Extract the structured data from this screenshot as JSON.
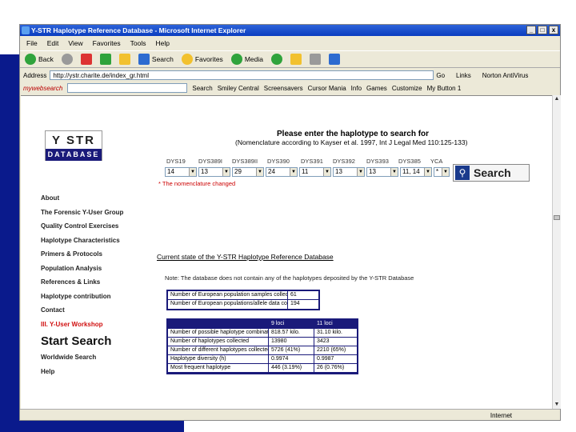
{
  "window": {
    "title": "Y-STR Haplotype Reference Database - Microsoft Internet Explorer",
    "buttons": [
      "_",
      "□",
      "x"
    ]
  },
  "menu": [
    "File",
    "Edit",
    "View",
    "Favorites",
    "Tools",
    "Help"
  ],
  "toolbar": {
    "back": "Back",
    "search": "Search",
    "favorites": "Favorites",
    "media": "Media"
  },
  "address": {
    "label": "Address",
    "url": "http://ystr.charite.de/index_gr.html",
    "go": "Go",
    "links": "Links",
    "norton": "Norton AntiVirus"
  },
  "searchbar": {
    "brand": "mywebsearch",
    "search": "Search",
    "smiley": "Smiley Central",
    "screensavers": "Screensavers",
    "cursor": "Cursor Mania",
    "info": "Info",
    "games": "Games",
    "customize": "Customize",
    "mybutton": "My Button 1"
  },
  "page": {
    "logo_top": "Y STR",
    "logo_bottom": "DATABASE",
    "heading": "Please enter the haplotype to search for",
    "subheading": "(Nomenclature according to Kayser et al. 1997, Int J Legal Med 110:125-133)",
    "loci": [
      {
        "name": "DYS19",
        "value": "14"
      },
      {
        "name": "DYS389I",
        "value": "13"
      },
      {
        "name": "DYS389II",
        "value": "29"
      },
      {
        "name": "DYS390",
        "value": "24"
      },
      {
        "name": "DYS391",
        "value": "11"
      },
      {
        "name": "DYS392",
        "value": "13"
      },
      {
        "name": "DYS393",
        "value": "13"
      },
      {
        "name": "DYS385",
        "value": "11, 14"
      },
      {
        "name": "YCA",
        "value": "*"
      }
    ],
    "note": "* The nomenclature changed",
    "search_button": "Search",
    "nav": [
      {
        "label": "About",
        "style": ""
      },
      {
        "label": "The Forensic Y-User Group",
        "style": ""
      },
      {
        "label": "Quality Control Exercises",
        "style": ""
      },
      {
        "label": "Haplotype Characteristics",
        "style": ""
      },
      {
        "label": "Primers & Protocols",
        "style": ""
      },
      {
        "label": "Population Analysis",
        "style": ""
      },
      {
        "label": "References & Links",
        "style": ""
      },
      {
        "label": "Haplotype contribution",
        "style": ""
      },
      {
        "label": "Contact",
        "style": ""
      },
      {
        "label": "III. Y-User Workshop",
        "style": "red"
      },
      {
        "label": "Start Search",
        "style": "big"
      },
      {
        "label": "Worldwide Search",
        "style": ""
      },
      {
        "label": "Help",
        "style": ""
      }
    ],
    "current_state": "Current state of the Y-STR Haplotype Reference Database",
    "notice": "Note: The database does not contain any of the haplotypes deposited by the Y-STR Database",
    "table1": [
      [
        "Number of European population samples collected",
        "61"
      ],
      [
        "Number of European populations/allele data counted",
        "194"
      ]
    ],
    "table2": {
      "headers": [
        "",
        "9 loci",
        "11 loci"
      ],
      "rows": [
        [
          "Number of possible haplotype combinations",
          "818.57 kilo.",
          "31.10 kilo."
        ],
        [
          "Number of haplotypes collected",
          "13980",
          "3423"
        ],
        [
          "Number of different haplotypes collected (%)",
          "5726 (41%)",
          "2210 (65%)"
        ],
        [
          "Haplotype diversity (h)",
          "0.9974",
          "0.9987"
        ],
        [
          "Most frequent haplotype",
          "446 (3.19%)",
          "26 (0.76%)"
        ]
      ]
    }
  },
  "status": {
    "zone": "Internet"
  },
  "colors": {
    "slide_blue": "#0a1a8c",
    "title_blue": "#0a3dbf",
    "table_navy": "#1a1a7a",
    "accent_red": "#d01010"
  }
}
